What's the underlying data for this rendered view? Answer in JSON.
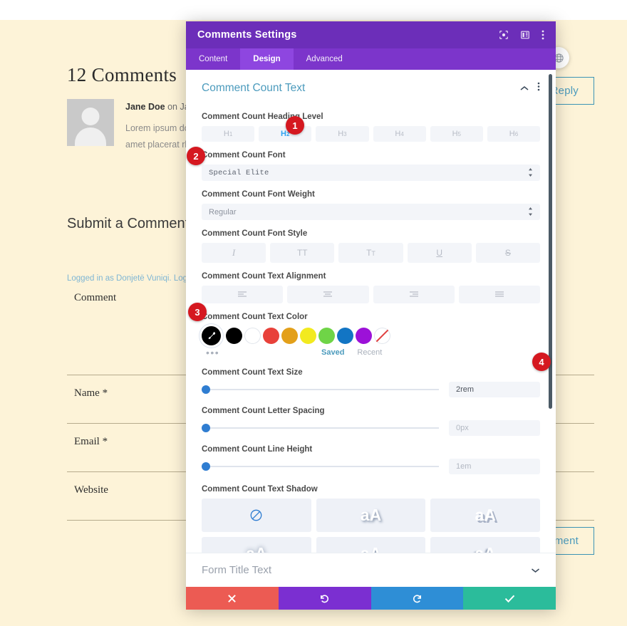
{
  "page": {
    "comments_heading": "12 Comments",
    "comment": {
      "author": "Jane Doe",
      "meta_suffix": " on January",
      "line1": "Lorem ipsum dolor sit",
      "line2": "amet placerat rhoncus"
    },
    "reply_label": "Reply",
    "submit_heading": "Submit a Comment",
    "logged_in": "Logged in as Donjetë Vuniqi. Log out?",
    "fields": [
      {
        "label": "Comment"
      },
      {
        "label": "Name *"
      },
      {
        "label": "Email *"
      },
      {
        "label": "Website"
      }
    ],
    "submit_button": "mment"
  },
  "modal": {
    "title": "Comments Settings",
    "header_icons": [
      "target-icon",
      "layout-icon",
      "kebab-menu-icon"
    ],
    "tabs": [
      {
        "label": "Content",
        "active": false
      },
      {
        "label": "Design",
        "active": true
      },
      {
        "label": "Advanced",
        "active": false
      }
    ],
    "section": {
      "title": "Comment Count Text",
      "collapse_icon": "chevron-up-icon",
      "menu_icon": "kebab-menu-icon"
    },
    "options": {
      "heading_level": {
        "label": "Comment Count Heading Level",
        "items": [
          {
            "label": "H",
            "sub": "1",
            "active": false
          },
          {
            "label": "H",
            "sub": "2",
            "active": true
          },
          {
            "label": "H",
            "sub": "3",
            "active": false
          },
          {
            "label": "H",
            "sub": "4",
            "active": false
          },
          {
            "label": "H",
            "sub": "5",
            "active": false
          },
          {
            "label": "H",
            "sub": "6",
            "active": false
          }
        ]
      },
      "font": {
        "label": "Comment Count Font",
        "value": "Special Elite"
      },
      "font_weight": {
        "label": "Comment Count Font Weight",
        "value": "Regular"
      },
      "font_style": {
        "label": "Comment Count Font Style",
        "items": [
          "italic-icon",
          "uppercase-icon",
          "capitalize-icon",
          "underline-icon",
          "strikethrough-icon"
        ]
      },
      "text_alignment": {
        "label": "Comment Count Text Alignment",
        "items": [
          "align-left-icon",
          "align-center-icon",
          "align-right-icon",
          "align-justify-icon"
        ]
      },
      "text_color": {
        "label": "Comment Count Text Color",
        "picker_icon": "eyedropper-icon",
        "swatches": [
          "#000000",
          "#ffffff",
          "#e8413a",
          "#e3a01a",
          "#f2ea1f",
          "#6fd447",
          "#1275c4",
          "#9c11d8",
          "none"
        ],
        "more_icon": "more-dots-icon",
        "saved_label": "Saved",
        "recent_label": "Recent"
      },
      "text_size": {
        "label": "Comment Count Text Size",
        "value": "2rem",
        "filled": true,
        "knob_percent": 1
      },
      "letter_spacing": {
        "label": "Comment Count Letter Spacing",
        "placeholder": "0px",
        "filled": false,
        "knob_percent": 0
      },
      "line_height": {
        "label": "Comment Count Line Height",
        "placeholder": "1em",
        "filled": false,
        "knob_percent": 0
      },
      "text_shadow": {
        "label": "Comment Count Text Shadow",
        "cells": [
          {
            "kind": "none",
            "glyph": "",
            "icon": "no-shadow-icon"
          },
          {
            "kind": "preset",
            "glyph": "aA",
            "icon": "shadow-bottom-right-icon"
          },
          {
            "kind": "preset",
            "glyph": "aA",
            "icon": "shadow-hard-icon"
          },
          {
            "kind": "preset",
            "glyph": "aA",
            "icon": "shadow-blur-icon"
          },
          {
            "kind": "preset",
            "glyph": "aA",
            "icon": "shadow-bottom-icon"
          },
          {
            "kind": "preset",
            "glyph": "aA",
            "icon": "shadow-left-icon"
          }
        ]
      }
    },
    "next_section": {
      "label": "Form Title Text",
      "chevron": "chevron-down-icon"
    },
    "actions": [
      {
        "name": "cancel",
        "icon": "close-icon",
        "color": "#ec5b53"
      },
      {
        "name": "undo",
        "icon": "undo-icon",
        "color": "#7b2fd1"
      },
      {
        "name": "redo",
        "icon": "redo-icon",
        "color": "#2e8ed6"
      },
      {
        "name": "save",
        "icon": "check-icon",
        "color": "#2bbc9b"
      }
    ]
  },
  "markers": [
    {
      "id": "1",
      "label": "1"
    },
    {
      "id": "2",
      "label": "2"
    },
    {
      "id": "3",
      "label": "3"
    },
    {
      "id": "4",
      "label": "4"
    }
  ],
  "colors": {
    "brand_purple": "#6c2eb9",
    "tab_purple": "#7c35cb",
    "accent_blue": "#4c9bbd",
    "page_cream": "#fdf3d8",
    "marker_red": "#d51820"
  }
}
